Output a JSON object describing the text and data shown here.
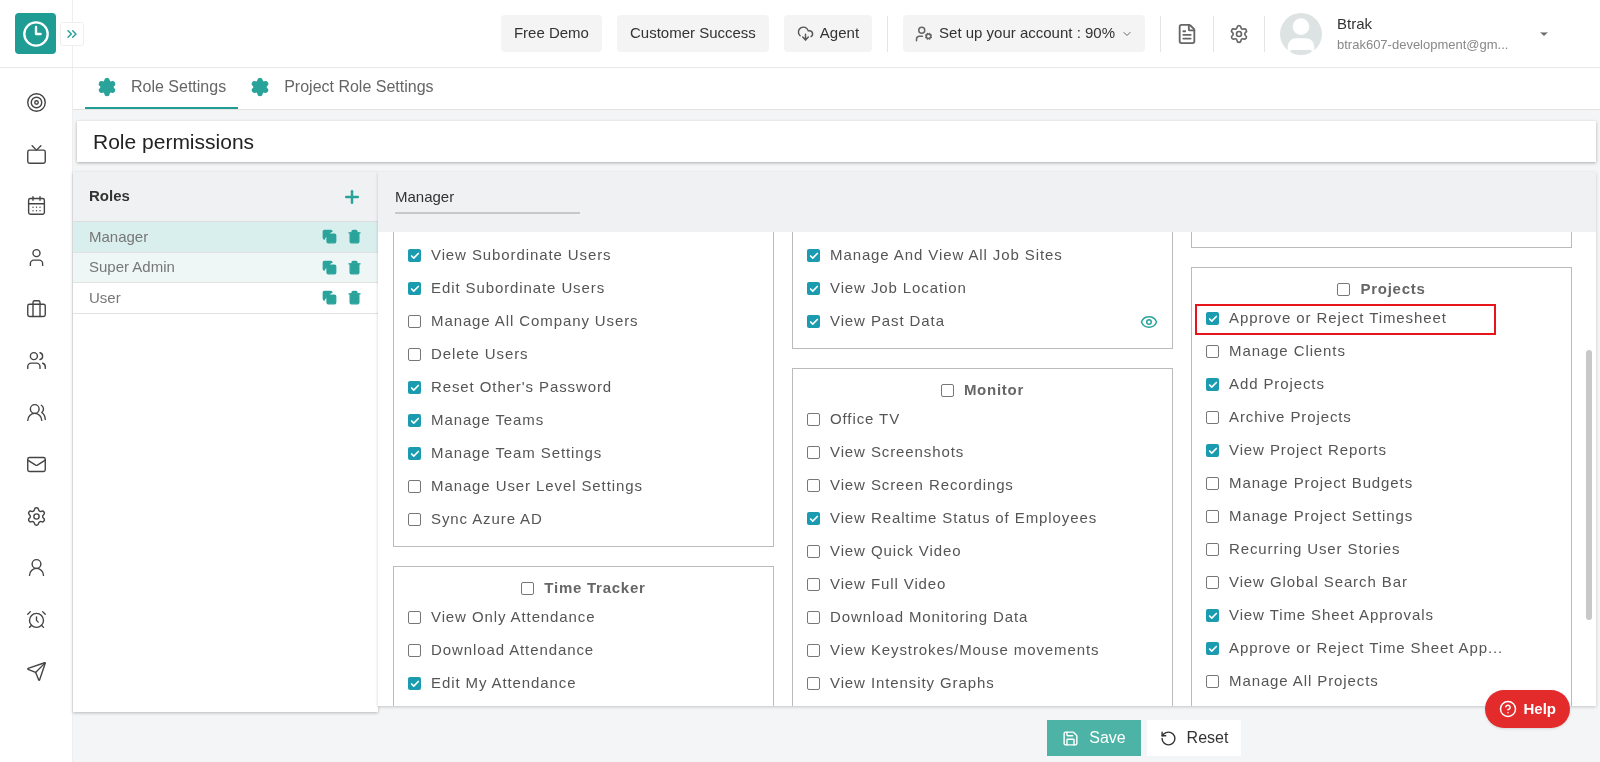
{
  "header": {
    "buttons": [
      {
        "label": "Free Demo",
        "kind": "plain"
      },
      {
        "label": "Customer Success",
        "kind": "plain"
      },
      {
        "label": "Agent",
        "kind": "agent"
      }
    ],
    "account_setup": "Set up your account : 90%",
    "user": {
      "name": "Btrak",
      "email": "btrak607-development@gm..."
    }
  },
  "tabs": [
    {
      "label": "Role Settings",
      "selected": true
    },
    {
      "label": "Project Role Settings",
      "selected": false
    }
  ],
  "page_title": "Role permissions",
  "roles": {
    "title": "Roles",
    "items": [
      {
        "name": "Manager",
        "selected": true,
        "hovered": false
      },
      {
        "name": "Super Admin",
        "selected": false,
        "hovered": true
      },
      {
        "name": "User",
        "selected": false,
        "hovered": false
      }
    ]
  },
  "selected_role": "Manager",
  "columns": [
    [
      {
        "kind": "continued",
        "items": [
          {
            "label": "View Subordinate Users",
            "checked": true
          },
          {
            "label": "Edit Subordinate Users",
            "checked": true
          },
          {
            "label": "Manage All Company Users",
            "checked": false
          },
          {
            "label": "Delete Users",
            "checked": false
          },
          {
            "label": "Reset Other's Password",
            "checked": true
          },
          {
            "label": "Manage Teams",
            "checked": true
          },
          {
            "label": "Manage Team Settings",
            "checked": true
          },
          {
            "label": "Manage User Level Settings",
            "checked": false
          },
          {
            "label": "Sync Azure AD",
            "checked": false
          }
        ]
      },
      {
        "kind": "section",
        "title": "Time Tracker",
        "checked": false,
        "items": [
          {
            "label": "View Only Attendance",
            "checked": false
          },
          {
            "label": "Download Attendance",
            "checked": false
          },
          {
            "label": "Edit My Attendance",
            "checked": true
          }
        ]
      }
    ],
    [
      {
        "kind": "continued",
        "items": [
          {
            "label": "Manage And View All Job Sites",
            "checked": true,
            "kind": "plain"
          },
          {
            "label": "View Job Location",
            "checked": true,
            "kind": "plain"
          },
          {
            "label": "View Past Data",
            "checked": true,
            "kind": "viewable"
          }
        ]
      },
      {
        "kind": "section",
        "title": "Monitor",
        "checked": false,
        "items": [
          {
            "label": "Office TV",
            "checked": false
          },
          {
            "label": "View Screenshots",
            "checked": false
          },
          {
            "label": "View Screen Recordings",
            "checked": false
          },
          {
            "label": "View Realtime Status of Employees",
            "checked": true
          },
          {
            "label": "View Quick Video",
            "checked": false
          },
          {
            "label": "View Full Video",
            "checked": false
          },
          {
            "label": "Download Monitoring Data",
            "checked": false
          },
          {
            "label": "View Keystrokes/Mouse movements",
            "checked": false
          },
          {
            "label": "View Intensity Graphs",
            "checked": false
          }
        ]
      }
    ],
    [
      {
        "kind": "fragment"
      },
      {
        "kind": "section",
        "title": "Projects",
        "checked": false,
        "items": [
          {
            "label": "Approve or Reject Timesheet",
            "checked": true,
            "highlighted": true
          },
          {
            "label": "Manage Clients",
            "checked": false,
            "highlighted": false
          },
          {
            "label": "Add Projects",
            "checked": true,
            "highlighted": false
          },
          {
            "label": "Archive Projects",
            "checked": false,
            "highlighted": false
          },
          {
            "label": "View Project Reports",
            "checked": true,
            "highlighted": false
          },
          {
            "label": "Manage Project Budgets",
            "checked": false,
            "highlighted": false
          },
          {
            "label": "Manage Project Settings",
            "checked": false,
            "highlighted": false
          },
          {
            "label": "Recurring User Stories",
            "checked": false,
            "highlighted": false
          },
          {
            "label": "View Global Search Bar",
            "checked": false,
            "highlighted": false
          },
          {
            "label": "View Time Sheet Approvals",
            "checked": true,
            "highlighted": false
          },
          {
            "label": "Approve or Reject Time Sheet App...",
            "checked": true,
            "highlighted": false
          },
          {
            "label": "Manage All Projects",
            "checked": false,
            "highlighted": false
          }
        ]
      }
    ]
  ],
  "help": "Help",
  "actions": [
    {
      "label": "Save",
      "kind": "save"
    },
    {
      "label": "Reset",
      "kind": "reset"
    }
  ]
}
